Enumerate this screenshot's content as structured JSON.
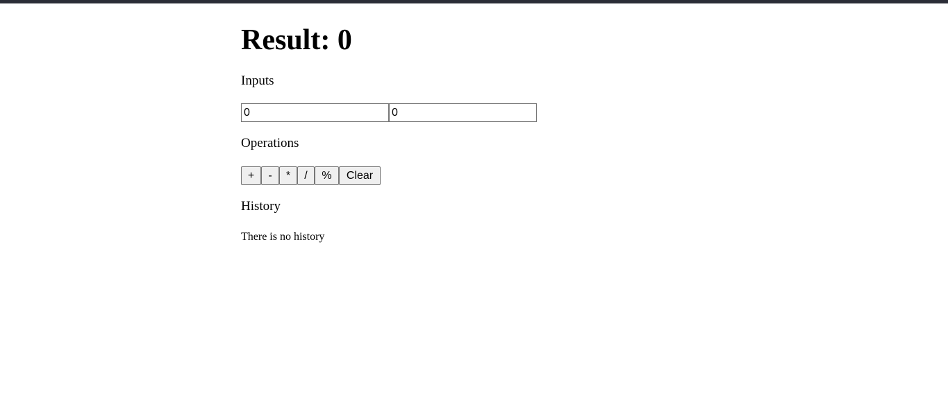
{
  "theme": {
    "top_bar_color": "#2b2d37"
  },
  "result": {
    "label": "Result: 0"
  },
  "inputs": {
    "heading": "Inputs",
    "first_value": "0",
    "second_value": "0"
  },
  "operations": {
    "heading": "Operations",
    "buttons": [
      {
        "label": "+"
      },
      {
        "label": "-"
      },
      {
        "label": "*"
      },
      {
        "label": "/"
      },
      {
        "label": "%"
      },
      {
        "label": "Clear"
      }
    ]
  },
  "history": {
    "heading": "History",
    "empty_text": "There is no history"
  }
}
